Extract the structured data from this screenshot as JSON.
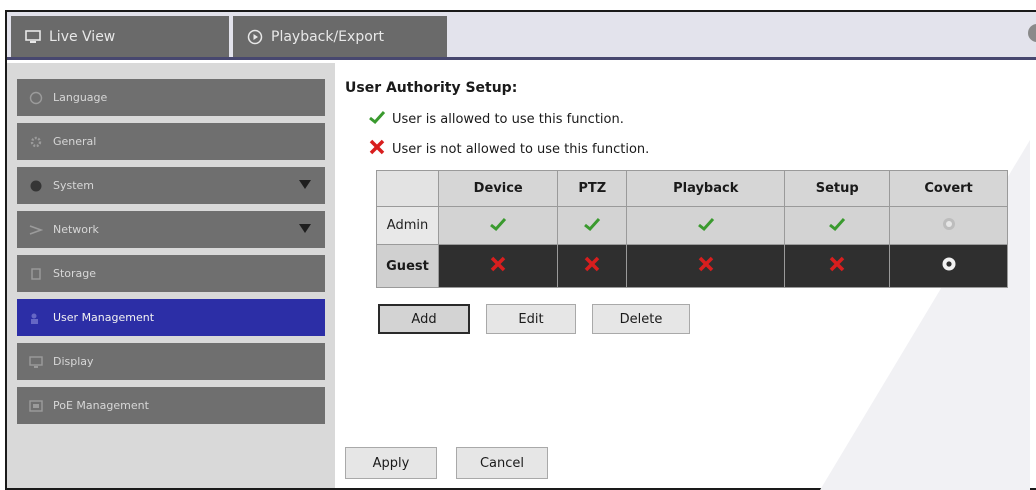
{
  "tabs": [
    {
      "label": "Live View",
      "icon": "monitor-icon"
    },
    {
      "label": "Playback/Export",
      "icon": "play-circle-icon"
    }
  ],
  "sidebar": {
    "items": [
      {
        "label": "Language",
        "icon": "globe-icon",
        "active": false,
        "expandable": false
      },
      {
        "label": "General",
        "icon": "gear-icon",
        "active": false,
        "expandable": false
      },
      {
        "label": "System",
        "icon": "system-icon",
        "active": false,
        "expandable": true
      },
      {
        "label": "Network",
        "icon": "network-icon",
        "active": false,
        "expandable": true
      },
      {
        "label": "Storage",
        "icon": "storage-icon",
        "active": false,
        "expandable": false
      },
      {
        "label": "User Management",
        "icon": "user-icon",
        "active": true,
        "expandable": false
      },
      {
        "label": "Display",
        "icon": "display-icon",
        "active": false,
        "expandable": false
      },
      {
        "label": "PoE Management",
        "icon": "poe-icon",
        "active": false,
        "expandable": false
      }
    ]
  },
  "main": {
    "title": "User Authority Setup:",
    "legend_allowed": "User is allowed to use this function.",
    "legend_denied": "User is not allowed to use this function.",
    "table": {
      "columns": [
        "Device",
        "PTZ",
        "Playback",
        "Setup",
        "Covert"
      ],
      "rows": [
        {
          "name": "Admin",
          "cells": [
            "allowed",
            "allowed",
            "allowed",
            "allowed",
            "covert-off"
          ]
        },
        {
          "name": "Guest",
          "cells": [
            "denied",
            "denied",
            "denied",
            "denied",
            "covert-on"
          ]
        }
      ]
    },
    "buttons": {
      "add": "Add",
      "edit": "Edit",
      "delete": "Delete"
    },
    "footer": {
      "apply": "Apply",
      "cancel": "Cancel"
    }
  },
  "colors": {
    "accent": "#2c2ea6",
    "allowed": "#3a9a2e",
    "denied": "#d81e1e",
    "sidebar_item": "#6f6f6f"
  }
}
